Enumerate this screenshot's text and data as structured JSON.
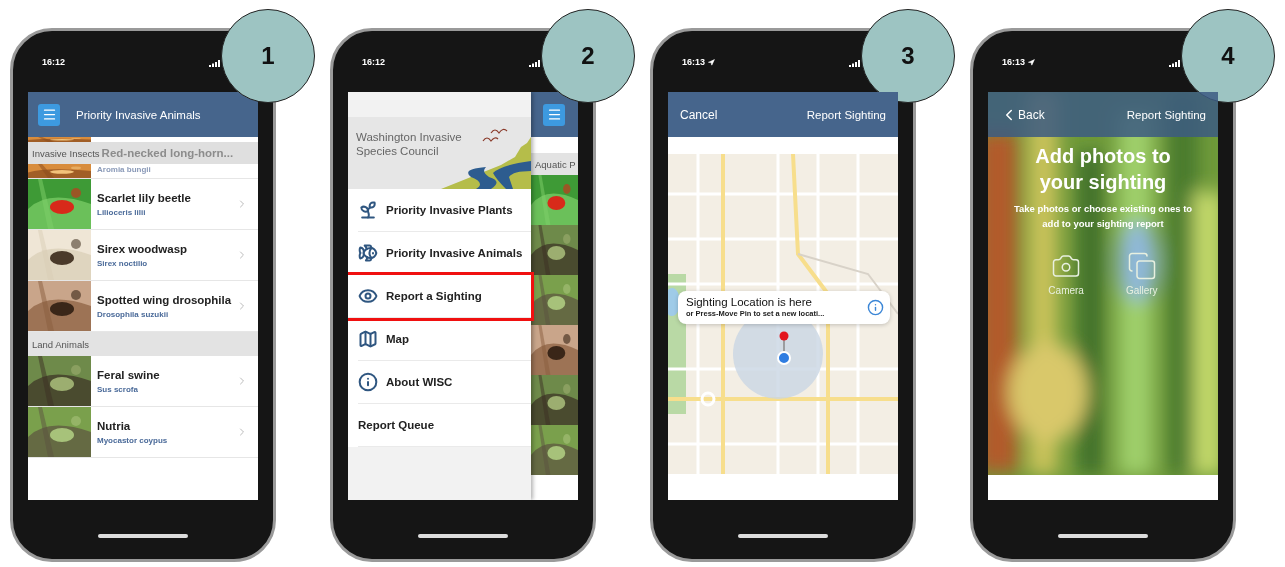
{
  "phones": [
    {
      "badge": "1",
      "time": "16:12",
      "location_arrow": false,
      "screen": {
        "kind": "list",
        "title": "Priority Invasive Animals",
        "sticky_header": "Invasive Insects",
        "partial_row": {
          "title": "Red-necked long-horn...",
          "subtitle": "Aromia bungii"
        },
        "sections": [
          {
            "rows": [
              {
                "title": "Scarlet lily beetle",
                "subtitle": "Lilioceris lilii"
              },
              {
                "title": "Sirex woodwasp",
                "subtitle": "Sirex noctilio"
              },
              {
                "title": "Spotted wing drosophila",
                "subtitle": "Drosophila suzukii"
              }
            ]
          },
          {
            "header": "Land Animals",
            "rows": [
              {
                "title": "Feral swine",
                "subtitle": "Sus scrofa"
              },
              {
                "title": "Nutria",
                "subtitle": "Myocastor coypus"
              }
            ]
          }
        ]
      }
    },
    {
      "badge": "2",
      "time": "16:12",
      "location_arrow": false,
      "screen": {
        "kind": "drawer",
        "logo": "Washington Invasive Species Council",
        "behind_section": "Aquatic P",
        "menu": [
          {
            "label": "Priority Invasive Plants",
            "highlighted": false
          },
          {
            "label": "Priority Invasive Animals",
            "highlighted": false
          },
          {
            "label": "Report a Sighting",
            "highlighted": true
          },
          {
            "label": "Map",
            "highlighted": false
          },
          {
            "label": "About WISC",
            "highlighted": false
          },
          {
            "label": "Report Queue",
            "highlighted": false
          }
        ]
      }
    },
    {
      "badge": "3",
      "time": "16:13",
      "location_arrow": true,
      "screen": {
        "kind": "map",
        "cancel": "Cancel",
        "title": "Report Sighting",
        "callout": {
          "title": "Sighting Location is here",
          "subtitle": "or Press-Move Pin to set a new locati..."
        }
      }
    },
    {
      "badge": "4",
      "time": "16:13",
      "location_arrow": true,
      "screen": {
        "kind": "photos",
        "back": "Back",
        "title": "Report Sighting",
        "heading": "Add photos to your sighting",
        "text": "Take photos or choose existing ones to add to your sighting report",
        "options": [
          "Camera",
          "Gallery"
        ]
      }
    }
  ]
}
